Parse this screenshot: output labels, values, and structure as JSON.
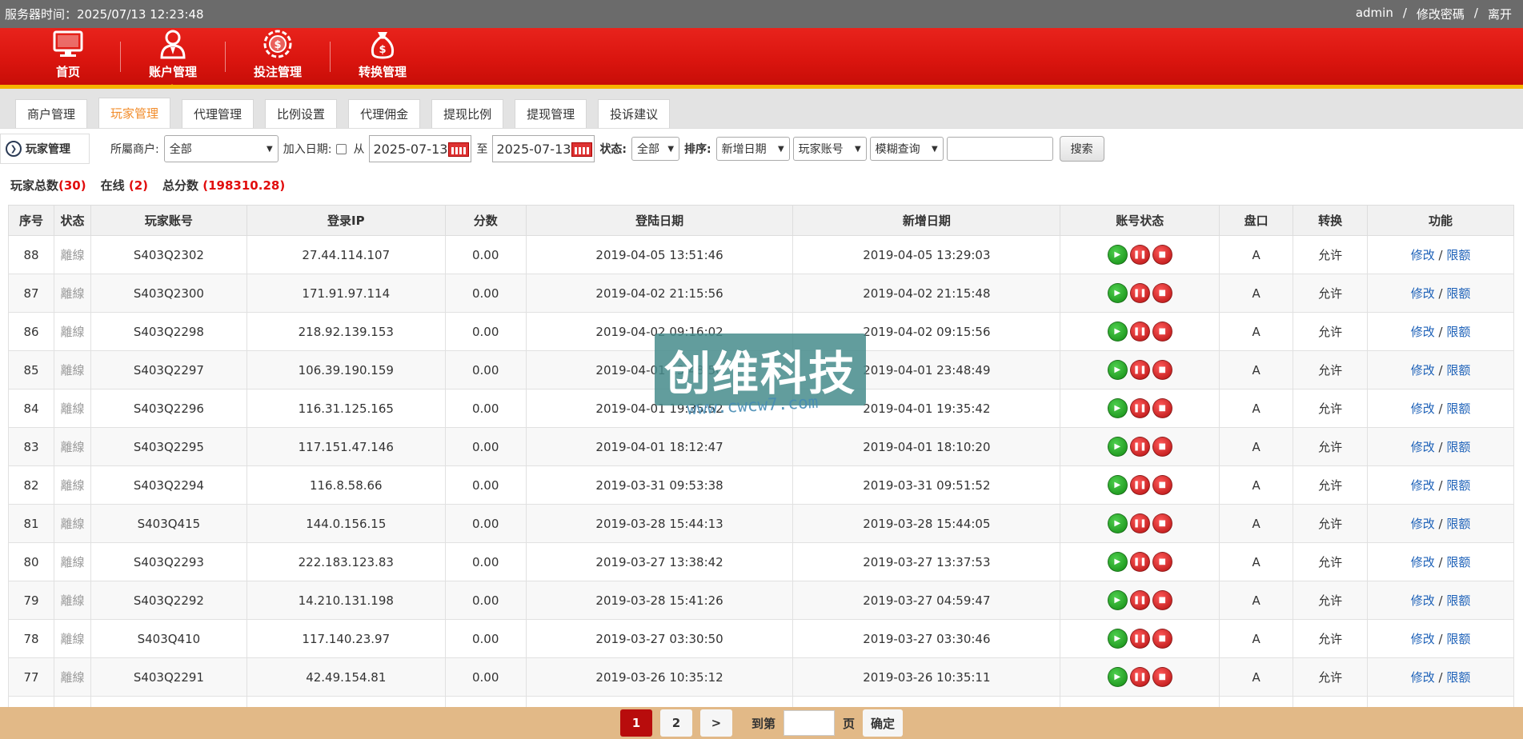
{
  "topbar": {
    "server_time": "服务器时间：2025/07/13 12:23:48",
    "user": "admin",
    "change_password": "修改密碼",
    "logout": "离开"
  },
  "nav": [
    {
      "label": "首页",
      "icon": "monitor-icon"
    },
    {
      "label": "账户管理",
      "icon": "user-icon"
    },
    {
      "label": "投注管理",
      "icon": "chip-icon"
    },
    {
      "label": "转换管理",
      "icon": "money-bag-icon"
    }
  ],
  "subtabs": [
    "商户管理",
    "玩家管理",
    "代理管理",
    "比例设置",
    "代理佣金",
    "提现比例",
    "提现管理",
    "投诉建议"
  ],
  "filter": {
    "module_title": "玩家管理",
    "merchant_label": "所屬商户:",
    "merchant_value": "全部",
    "join_date_label": "加入日期:",
    "from_label": "从",
    "date_from": "2025-07-13",
    "to_label": "至",
    "date_to": "2025-07-13",
    "status_label": "状态:",
    "status_value": "全部",
    "sort_label": "排序:",
    "sort_value": "新增日期",
    "field_value": "玩家账号",
    "match_value": "模糊查询",
    "search_button": "搜索"
  },
  "summary": {
    "total_label": "玩家总数",
    "total_value": "(30)",
    "online_label": "在线",
    "online_value": "(2)",
    "score_label": "总分数",
    "score_value": "(198310.28)"
  },
  "table": {
    "headers": [
      "序号",
      "状态",
      "玩家账号",
      "登录IP",
      "分数",
      "登陆日期",
      "新增日期",
      "账号状态",
      "盘口",
      "转换",
      "功能"
    ],
    "rows": [
      {
        "id": "88",
        "status": "離線",
        "account": "S403Q2302",
        "ip": "27.44.114.107",
        "score": "0.00",
        "login": "2019-04-05 13:51:46",
        "created": "2019-04-05 13:29:03",
        "pan": "A",
        "convert": "允许"
      },
      {
        "id": "87",
        "status": "離線",
        "account": "S403Q2300",
        "ip": "171.91.97.114",
        "score": "0.00",
        "login": "2019-04-02 21:15:56",
        "created": "2019-04-02 21:15:48",
        "pan": "A",
        "convert": "允许"
      },
      {
        "id": "86",
        "status": "離線",
        "account": "S403Q2298",
        "ip": "218.92.139.153",
        "score": "0.00",
        "login": "2019-04-02 09:16:02",
        "created": "2019-04-02 09:15:56",
        "pan": "A",
        "convert": "允许"
      },
      {
        "id": "85",
        "status": "離線",
        "account": "S403Q2297",
        "ip": "106.39.190.159",
        "score": "0.00",
        "login": "2019-04-01 23:48:50",
        "created": "2019-04-01 23:48:49",
        "pan": "A",
        "convert": "允许"
      },
      {
        "id": "84",
        "status": "離線",
        "account": "S403Q2296",
        "ip": "116.31.125.165",
        "score": "0.00",
        "login": "2019-04-01 19:35:52",
        "created": "2019-04-01 19:35:42",
        "pan": "A",
        "convert": "允许"
      },
      {
        "id": "83",
        "status": "離線",
        "account": "S403Q2295",
        "ip": "117.151.47.146",
        "score": "0.00",
        "login": "2019-04-01 18:12:47",
        "created": "2019-04-01 18:10:20",
        "pan": "A",
        "convert": "允许"
      },
      {
        "id": "82",
        "status": "離線",
        "account": "S403Q2294",
        "ip": "116.8.58.66",
        "score": "0.00",
        "login": "2019-03-31 09:53:38",
        "created": "2019-03-31 09:51:52",
        "pan": "A",
        "convert": "允许"
      },
      {
        "id": "81",
        "status": "離線",
        "account": "S403Q415",
        "ip": "144.0.156.15",
        "score": "0.00",
        "login": "2019-03-28 15:44:13",
        "created": "2019-03-28 15:44:05",
        "pan": "A",
        "convert": "允许"
      },
      {
        "id": "80",
        "status": "離線",
        "account": "S403Q2293",
        "ip": "222.183.123.83",
        "score": "0.00",
        "login": "2019-03-27 13:38:42",
        "created": "2019-03-27 13:37:53",
        "pan": "A",
        "convert": "允许"
      },
      {
        "id": "79",
        "status": "離線",
        "account": "S403Q2292",
        "ip": "14.210.131.198",
        "score": "0.00",
        "login": "2019-03-28 15:41:26",
        "created": "2019-03-27 04:59:47",
        "pan": "A",
        "convert": "允许"
      },
      {
        "id": "78",
        "status": "離線",
        "account": "S403Q410",
        "ip": "117.140.23.97",
        "score": "0.00",
        "login": "2019-03-27 03:30:50",
        "created": "2019-03-27 03:30:46",
        "pan": "A",
        "convert": "允许"
      },
      {
        "id": "77",
        "status": "離線",
        "account": "S403Q2291",
        "ip": "42.49.154.81",
        "score": "0.00",
        "login": "2019-03-26 10:35:12",
        "created": "2019-03-26 10:35:11",
        "pan": "A",
        "convert": "允许"
      }
    ],
    "edit_label": "修改",
    "limit_label": "限额"
  },
  "watermark": {
    "text": "创维科技",
    "url": "www.cwcw7.com"
  },
  "pager": {
    "page1": "1",
    "page2": "2",
    "next": ">",
    "goto_label": "到第",
    "page_unit": "页",
    "confirm": "确定"
  }
}
